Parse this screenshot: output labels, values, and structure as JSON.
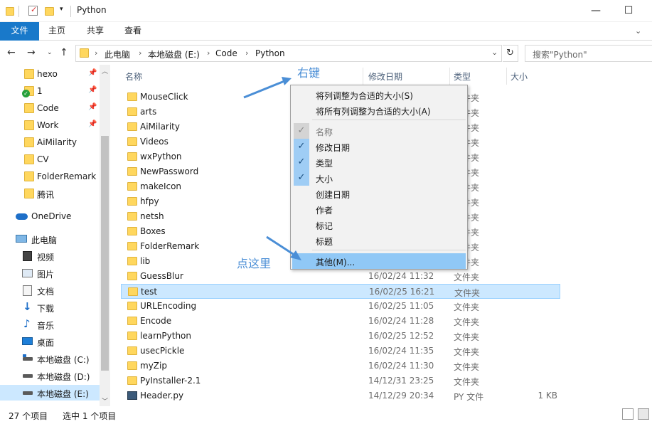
{
  "window": {
    "title": "Python",
    "minimize": "—",
    "maximize": "☐"
  },
  "ribbon": {
    "tabs": [
      "文件",
      "主页",
      "共享",
      "查看"
    ]
  },
  "address": {
    "segments": [
      "此电脑",
      "本地磁盘 (E:)",
      "Code",
      "Python"
    ],
    "search_placeholder": "搜索\"Python\""
  },
  "nav_pane": {
    "quick_access": [
      {
        "label": "hexo",
        "pinned": true
      },
      {
        "label": "1",
        "pinned": true
      },
      {
        "label": "Code",
        "pinned": true
      },
      {
        "label": "Work",
        "pinned": true
      },
      {
        "label": "AiMilarity",
        "pinned": false
      },
      {
        "label": "CV",
        "pinned": false
      },
      {
        "label": "FolderRemark",
        "pinned": false
      },
      {
        "label": "腾讯",
        "pinned": false
      }
    ],
    "onedrive": "OneDrive",
    "this_pc": "此电脑",
    "pc_items": [
      "视频",
      "图片",
      "文档",
      "下载",
      "音乐",
      "桌面",
      "本地磁盘 (C:)",
      "本地磁盘 (D:)",
      "本地磁盘 (E:)"
    ],
    "selected": "本地磁盘 (E:)"
  },
  "columns": {
    "name": "名称",
    "date": "修改日期",
    "type": "类型",
    "size": "大小"
  },
  "files": [
    {
      "name": "MouseClick",
      "date": "",
      "type": "文件夹",
      "size": ""
    },
    {
      "name": "arts",
      "date": "",
      "type": "文件夹",
      "size": ""
    },
    {
      "name": "AiMilarity",
      "date": "",
      "type": "文件夹",
      "size": ""
    },
    {
      "name": "Videos",
      "date": "",
      "type": "文件夹",
      "size": ""
    },
    {
      "name": "wxPython",
      "date": "",
      "type": "文件夹",
      "size": ""
    },
    {
      "name": "NewPassword",
      "date": "",
      "type": "文件夹",
      "size": ""
    },
    {
      "name": "makeIcon",
      "date": "",
      "type": "文件夹",
      "size": ""
    },
    {
      "name": "hfpy",
      "date": "",
      "type": "文件夹",
      "size": ""
    },
    {
      "name": "netsh",
      "date": "",
      "type": "文件夹",
      "size": ""
    },
    {
      "name": "Boxes",
      "date": "",
      "type": "文件夹",
      "size": ""
    },
    {
      "name": "FolderRemark",
      "date": "",
      "type": "文件夹",
      "size": ""
    },
    {
      "name": "lib",
      "date": "",
      "type": "文件夹",
      "size": ""
    },
    {
      "name": "GuessBlur",
      "date": "16/02/24 11:32",
      "type": "文件夹",
      "size": ""
    },
    {
      "name": "test",
      "date": "16/02/25 16:21",
      "type": "文件夹",
      "size": ""
    },
    {
      "name": "URLEncoding",
      "date": "16/02/25 11:05",
      "type": "文件夹",
      "size": ""
    },
    {
      "name": "Encode",
      "date": "16/02/24 11:28",
      "type": "文件夹",
      "size": ""
    },
    {
      "name": "learnPython",
      "date": "16/02/25 12:52",
      "type": "文件夹",
      "size": ""
    },
    {
      "name": "usecPickle",
      "date": "16/02/24 11:35",
      "type": "文件夹",
      "size": ""
    },
    {
      "name": "myZip",
      "date": "16/02/24 11:30",
      "type": "文件夹",
      "size": ""
    },
    {
      "name": "PyInstaller-2.1",
      "date": "14/12/31 23:25",
      "type": "文件夹",
      "size": ""
    },
    {
      "name": "Header.py",
      "date": "14/12/29 20:34",
      "type": "PY 文件",
      "size": "1 KB"
    }
  ],
  "selected_file": "test",
  "context_menu": {
    "items": [
      {
        "label": "将列调整为合适的大小(S)",
        "checked": false,
        "disabled": false
      },
      {
        "label": "将所有列调整为合适的大小(A)",
        "checked": false,
        "disabled": false
      },
      {
        "label": "名称",
        "checked": true,
        "disabled": true
      },
      {
        "label": "修改日期",
        "checked": true,
        "disabled": false
      },
      {
        "label": "类型",
        "checked": true,
        "disabled": false
      },
      {
        "label": "大小",
        "checked": true,
        "disabled": false
      },
      {
        "label": "创建日期",
        "checked": false,
        "disabled": false
      },
      {
        "label": "作者",
        "checked": false,
        "disabled": false
      },
      {
        "label": "标记",
        "checked": false,
        "disabled": false
      },
      {
        "label": "标题",
        "checked": false,
        "disabled": false
      },
      {
        "label": "其他(M)...",
        "checked": false,
        "disabled": false,
        "highlighted": true
      }
    ]
  },
  "annotations": {
    "right_click": "右键",
    "click_here": "点这里"
  },
  "status": {
    "count": "27 个项目",
    "selection": "选中 1 个项目"
  },
  "colors": {
    "accent": "#1979ca",
    "selection": "#cce8ff",
    "annotation": "#4a8ed6",
    "menu_highlight": "#90c8f6"
  }
}
